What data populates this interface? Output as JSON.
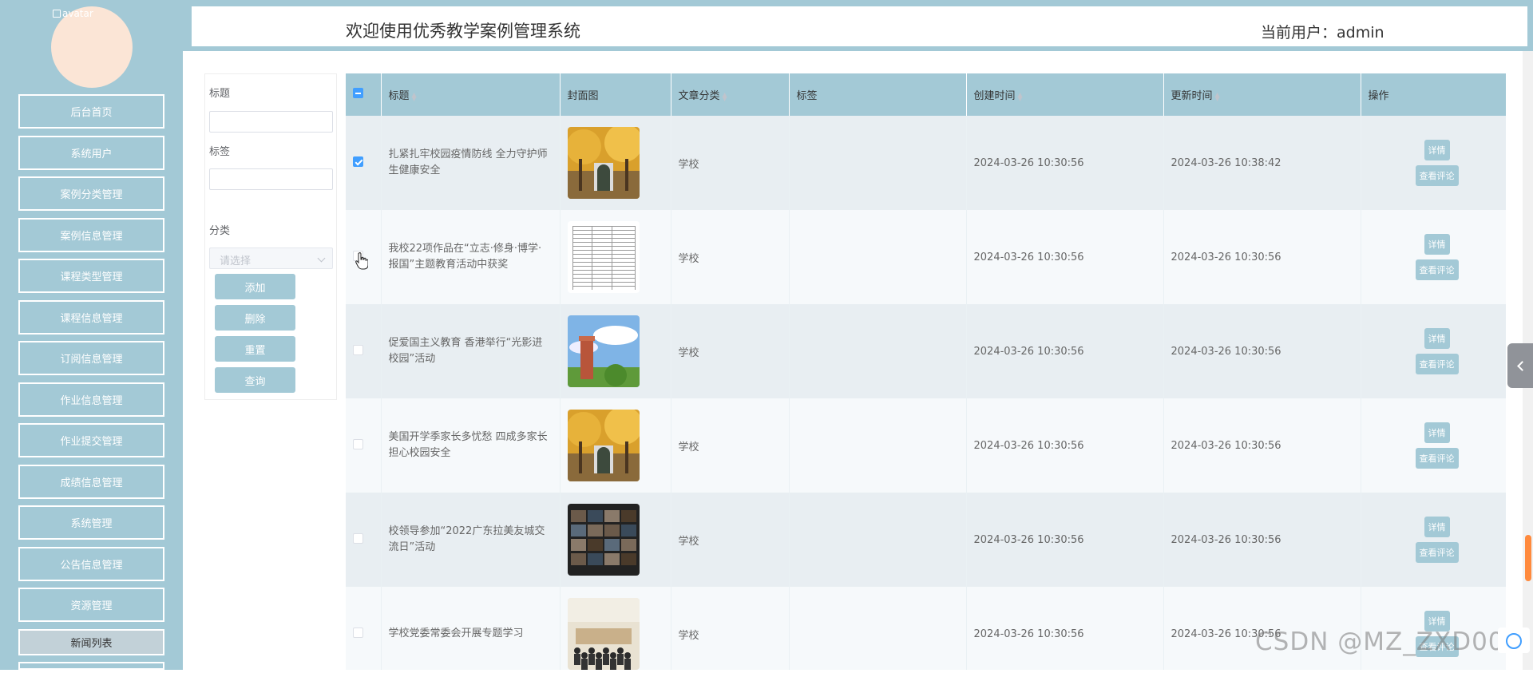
{
  "sidebar": {
    "avatar_alt": "avatar",
    "items": [
      {
        "label": "后台首页",
        "active": false
      },
      {
        "label": "系统用户",
        "active": false
      },
      {
        "label": "案例分类管理",
        "active": false
      },
      {
        "label": "案例信息管理",
        "active": false
      },
      {
        "label": "课程类型管理",
        "active": false
      },
      {
        "label": "课程信息管理",
        "active": false
      },
      {
        "label": "订阅信息管理",
        "active": false
      },
      {
        "label": "作业信息管理",
        "active": false
      },
      {
        "label": "作业提交管理",
        "active": false
      },
      {
        "label": "成绩信息管理",
        "active": false
      },
      {
        "label": "系统管理",
        "active": false
      },
      {
        "label": "公告信息管理",
        "active": false
      },
      {
        "label": "资源管理",
        "active": false
      },
      {
        "label": "新闻列表",
        "active": true
      }
    ]
  },
  "header": {
    "title": "欢迎使用优秀教学案例管理系统",
    "current_user": "当前用户：admin"
  },
  "filters": {
    "title_label": "标题",
    "title_value": "",
    "tag_label": "标签",
    "tag_value": "",
    "category_label": "分类",
    "category_placeholder": "请选择",
    "buttons": {
      "add": "添加",
      "delete": "删除",
      "reset": "重置",
      "query": "查询"
    }
  },
  "table": {
    "columns": [
      "标题",
      "封面图",
      "文章分类",
      "标签",
      "创建时间",
      "更新时间",
      "操作"
    ],
    "detail_btn": "详情",
    "comment_btn": "查看评论",
    "rows": [
      {
        "checked": true,
        "title": "扎紧扎牢校园疫情防线 全力守护师生健康安全",
        "category": "学校",
        "tag": "",
        "created": "2024-03-26 10:30:56",
        "updated": "2024-03-26 10:38:42",
        "thumb": "autumn-gate"
      },
      {
        "checked": false,
        "title": "我校22项作品在“立志·修身·博学·报国”主题教育活动中获奖",
        "category": "学校",
        "tag": "",
        "created": "2024-03-26 10:30:56",
        "updated": "2024-03-26 10:30:56",
        "thumb": "document"
      },
      {
        "checked": false,
        "title": "促爱国主义教育 香港举行“光影进校园”活动",
        "category": "学校",
        "tag": "",
        "created": "2024-03-26 10:30:56",
        "updated": "2024-03-26 10:30:56",
        "thumb": "tower-sky"
      },
      {
        "checked": false,
        "title": "美国开学季家长多忧愁 四成多家长担心校园安全",
        "category": "学校",
        "tag": "",
        "created": "2024-03-26 10:30:56",
        "updated": "2024-03-26 10:30:56",
        "thumb": "autumn-gate"
      },
      {
        "checked": false,
        "title": "校领导参加“2022广东拉美友城交流日”活动",
        "category": "学校",
        "tag": "",
        "created": "2024-03-26 10:30:56",
        "updated": "2024-03-26 10:30:56",
        "thumb": "video-grid"
      },
      {
        "checked": false,
        "title": "学校党委常委会开展专题学习",
        "category": "学校",
        "tag": "",
        "created": "2024-03-26 10:30:56",
        "updated": "2024-03-26 10:30:56",
        "thumb": "meeting-room"
      }
    ]
  },
  "watermark": "CSDN @MZ_ZXD001",
  "colors": {
    "theme": "#a3c9d6",
    "checkbox": "#409eff"
  }
}
